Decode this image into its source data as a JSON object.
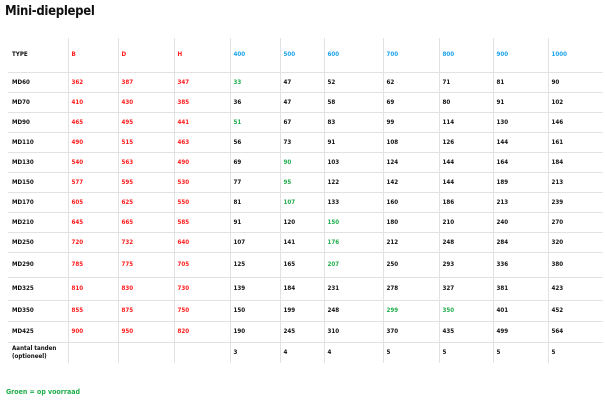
{
  "title": "Mini-dieplepel",
  "note": "Groen = op voorraad",
  "colors": {
    "dimension_header": "#ff1a1a",
    "width_header": "#1aa3e8",
    "in_stock": "#1fae4b",
    "text": "#111111"
  },
  "table": {
    "header": [
      "TYPE",
      "B",
      "D",
      "H",
      "400",
      "500",
      "600",
      "700",
      "800",
      "900",
      "1000"
    ],
    "rows": [
      [
        "MD60",
        "362",
        "387",
        "347",
        "33",
        "47",
        "52",
        "62",
        "71",
        "81",
        "90"
      ],
      [
        "MD70",
        "410",
        "430",
        "385",
        "36",
        "47",
        "58",
        "69",
        "80",
        "91",
        "102"
      ],
      [
        "MD90",
        "465",
        "495",
        "441",
        "51",
        "67",
        "83",
        "99",
        "114",
        "130",
        "146"
      ],
      [
        "MD110",
        "490",
        "515",
        "463",
        "56",
        "73",
        "91",
        "108",
        "126",
        "144",
        "161"
      ],
      [
        "MD130",
        "540",
        "563",
        "490",
        "69",
        "90",
        "103",
        "124",
        "144",
        "164",
        "184"
      ],
      [
        "MD150",
        "577",
        "595",
        "530",
        "77",
        "95",
        "122",
        "142",
        "144",
        "189",
        "213"
      ],
      [
        "MD170",
        "605",
        "625",
        "550",
        "81",
        "107",
        "133",
        "160",
        "186",
        "213",
        "239"
      ],
      [
        "MD210",
        "645",
        "665",
        "585",
        "91",
        "120",
        "150",
        "180",
        "210",
        "240",
        "270"
      ],
      [
        "MD250",
        "720",
        "732",
        "640",
        "107",
        "141",
        "176",
        "212",
        "248",
        "284",
        "320"
      ],
      [
        "MD290",
        "785",
        "775",
        "705",
        "125",
        "165",
        "207",
        "250",
        "293",
        "336",
        "380"
      ],
      [
        "MD325",
        "810",
        "830",
        "730",
        "139",
        "184",
        "231",
        "278",
        "327",
        "381",
        "423"
      ],
      [
        "MD350",
        "855",
        "875",
        "750",
        "150",
        "199",
        "248",
        "299",
        "350",
        "401",
        "452"
      ],
      [
        "MD425",
        "900",
        "950",
        "820",
        "190",
        "245",
        "310",
        "370",
        "435",
        "499",
        "564"
      ]
    ],
    "teeth_label": "Aantal tanden (optioneel)",
    "teeth": [
      "3",
      "4",
      "4",
      "5",
      "5",
      "5",
      "5"
    ]
  }
}
